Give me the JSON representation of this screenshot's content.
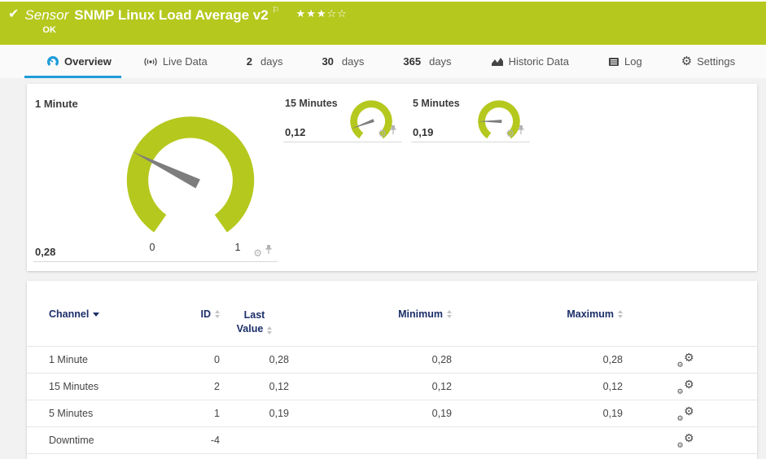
{
  "colors": {
    "green": "#B5C81E",
    "blue": "#1E9CD8",
    "navy": "#1B2E68"
  },
  "icons": {
    "check": "✔",
    "flag": "⚐",
    "star_filled": "★",
    "star_empty": "☆",
    "gear": "⚙"
  },
  "header": {
    "kind_label": "Sensor",
    "title": "SNMP Linux Load Average v2",
    "status": "OK",
    "priority_stars_filled": 3,
    "priority_stars_total": 5
  },
  "tabs": [
    {
      "label": "Overview",
      "active": true
    },
    {
      "label": "Live Data"
    },
    {
      "num": "2",
      "label": "days"
    },
    {
      "num": "30",
      "label": "days"
    },
    {
      "num": "365",
      "label": "days"
    },
    {
      "label": "Historic Data"
    },
    {
      "label": "Log"
    },
    {
      "label": "Settings"
    }
  ],
  "gauges": [
    {
      "name": "1 Minute",
      "value": 0.28,
      "value_display": "0,28",
      "min": 0,
      "max": 1,
      "min_label": "0",
      "max_label": "1",
      "size": "large"
    },
    {
      "name": "15 Minutes",
      "value": 0.12,
      "value_display": "0,12",
      "min": 0,
      "max": 1,
      "size": "small"
    },
    {
      "name": "5 Minutes",
      "value": 0.19,
      "value_display": "0,19",
      "min": 0,
      "max": 1,
      "size": "small"
    }
  ],
  "table": {
    "columns": {
      "channel": "Channel",
      "id": "ID",
      "last1": "Last",
      "last2": "Value",
      "min": "Minimum",
      "max": "Maximum"
    },
    "rows": [
      {
        "channel": "1 Minute",
        "id": "0",
        "last": "0,28",
        "min": "0,28",
        "max": "0,28"
      },
      {
        "channel": "15 Minutes",
        "id": "2",
        "last": "0,12",
        "min": "0,12",
        "max": "0,12"
      },
      {
        "channel": "5 Minutes",
        "id": "1",
        "last": "0,19",
        "min": "0,19",
        "max": "0,19"
      },
      {
        "channel": "Downtime",
        "id": "-4",
        "last": "",
        "min": "",
        "max": ""
      }
    ]
  }
}
